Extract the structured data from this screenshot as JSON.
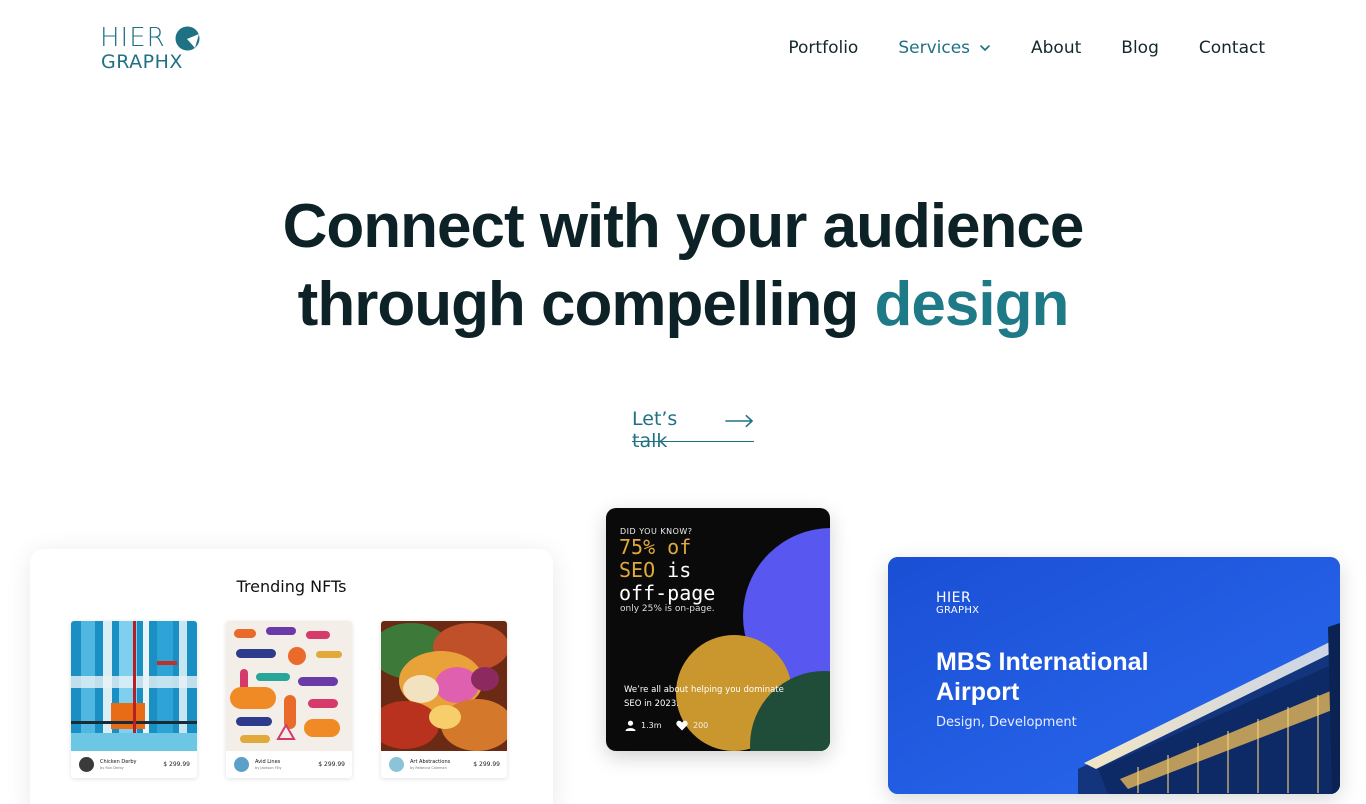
{
  "header": {
    "logo_top": "HIER",
    "logo_bottom": "GRAPHX",
    "nav": [
      {
        "label": "Portfolio"
      },
      {
        "label": "Services"
      },
      {
        "label": "About"
      },
      {
        "label": "Blog"
      },
      {
        "label": "Contact"
      }
    ]
  },
  "hero": {
    "line1": "Connect with your audience",
    "line2_prefix": "through compelling ",
    "line2_accent": "design",
    "cta_label": "Let’s talk"
  },
  "nft_card": {
    "title": "Trending NFTs",
    "items": [
      {
        "name": "Chicken Derby",
        "author": "by Ron Derby",
        "price": "$ 299.99"
      },
      {
        "name": "Avid Lines",
        "author": "by Jackson Filly",
        "price": "$ 299.99"
      },
      {
        "name": "Art Abstractions",
        "author": "by Rebecca Coleman",
        "price": "$ 299.99"
      }
    ]
  },
  "seo_card": {
    "kicker": "DID YOU KNOW?",
    "line1": "75% of",
    "line2_accent": "SEO",
    "line2_rest": " is",
    "line3": "off-page",
    "sub": "only 25% is on-page.",
    "body": "We’re all about helping you dominate SEO in 2023.",
    "followers": "1.3m",
    "likes": "200"
  },
  "airport_card": {
    "logo_top": "HIER",
    "logo_bottom": "GRAPHX",
    "title": "MBS International Airport",
    "subtitle": "Design, Development"
  },
  "colors": {
    "brand_teal": "#1f7184",
    "heading": "#0d2226",
    "seo_gold": "#e0a93a",
    "seo_purple": "#5858f0",
    "airport_blue": "#1d55d6"
  }
}
